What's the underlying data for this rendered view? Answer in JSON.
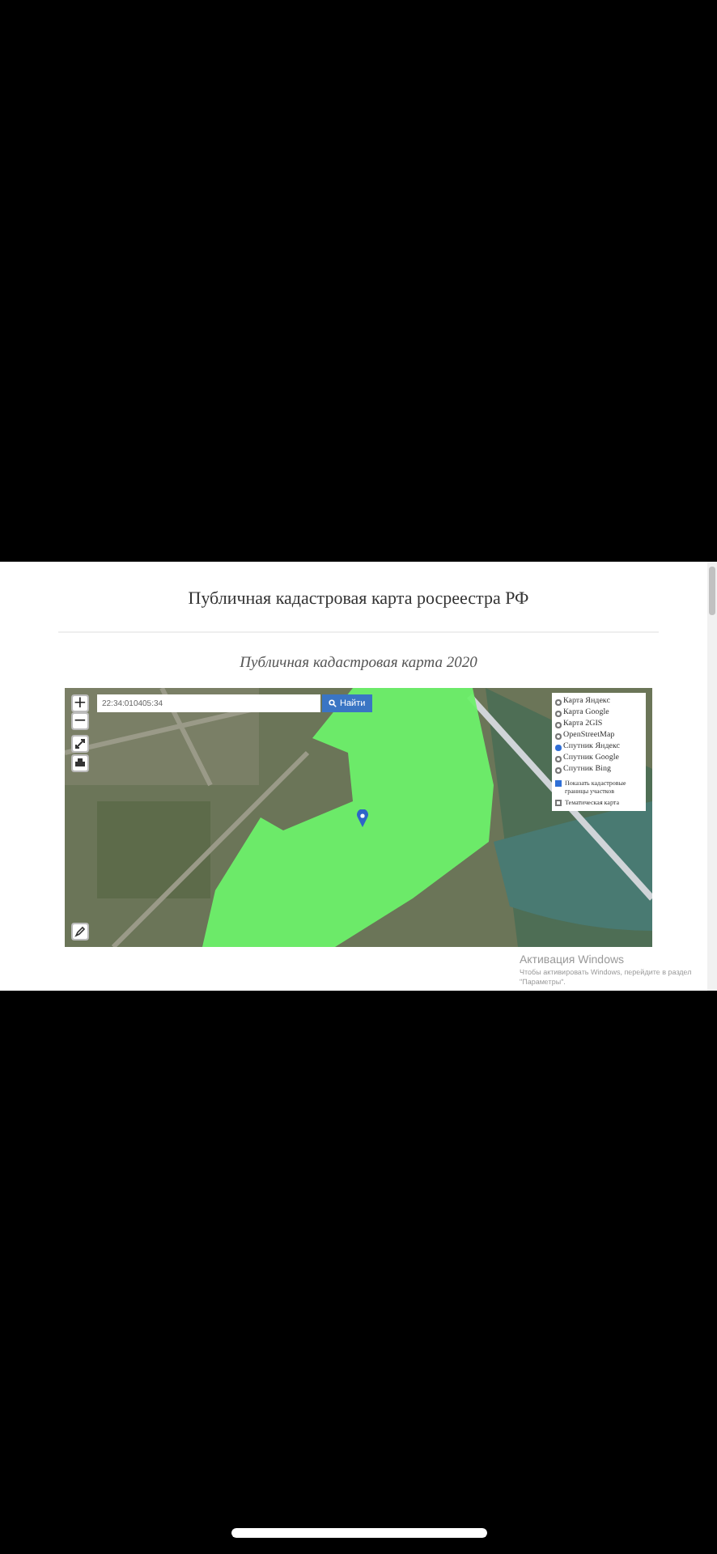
{
  "page": {
    "title": "Публичная кадастровая карта росреестра РФ",
    "subtitle": "Публичная кадастровая карта 2020"
  },
  "map": {
    "search": {
      "value": "22:34:010405:34"
    },
    "search_button": "Найти",
    "zoom_in": "+",
    "zoom_out": "−",
    "layers": [
      {
        "label": "Карта Яндекс",
        "selected": false
      },
      {
        "label": "Карта Google",
        "selected": false
      },
      {
        "label": "Карта 2GIS",
        "selected": false
      },
      {
        "label": "OpenStreetMap",
        "selected": false
      },
      {
        "label": "Спутник Яндекс",
        "selected": true
      },
      {
        "label": "Спутник Google",
        "selected": false
      },
      {
        "label": "Спутник Bing",
        "selected": false
      }
    ],
    "options": [
      {
        "label": "Показать кадастровые границы участков",
        "checked": true
      },
      {
        "label": "Тематическая карта",
        "checked": false
      }
    ]
  },
  "windows_notice": {
    "title": "Активация Windows",
    "text": "Чтобы активировать Windows, перейдите в раздел \"Параметры\"."
  }
}
